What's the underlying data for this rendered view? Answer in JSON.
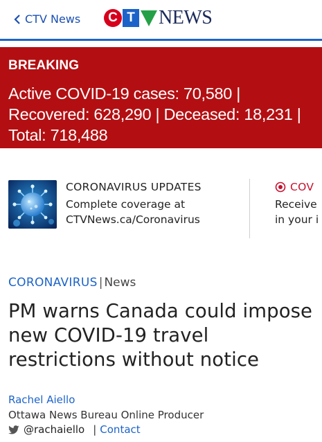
{
  "header": {
    "back_label": "CTV News",
    "logo_news_text": "NEWS",
    "logo_c": "C",
    "logo_t": "T",
    "brand_colors": {
      "red": "#d6001c",
      "blue": "#1c63c9",
      "navy": "#1b2a5a"
    }
  },
  "breaking": {
    "label": "BREAKING",
    "text": "Active COVID-19 cases: 70,580 |\nRecovered: 628,290 | Deceased: 18,231 |\nTotal: 718,488",
    "background": "#b30f12"
  },
  "promos": [
    {
      "title": "CORONAVIRUS UPDATES",
      "line1": "Complete coverage at",
      "line2": "CTVNews.ca/Coronavirus",
      "icon": "coronavirus-thumbnail"
    },
    {
      "title": "COV",
      "line1": "Receive",
      "line2": "in your i",
      "icon": "record-icon"
    }
  ],
  "article": {
    "category": "CORONAVIRUS",
    "section": "News",
    "headline": "PM warns Canada could impose new COVID-19 travel restrictions without notice",
    "author": "Rachel Aiello",
    "author_role": "Ottawa News Bureau Online Producer",
    "twitter_handle": "@rachaiello",
    "contact_label": "Contact"
  }
}
